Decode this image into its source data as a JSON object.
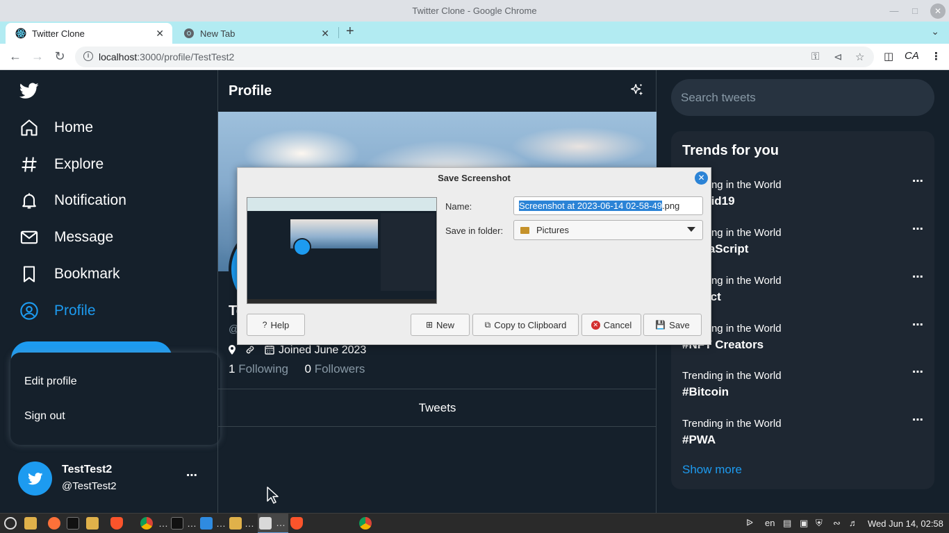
{
  "window": {
    "title": "Twitter Clone - Google Chrome"
  },
  "tabs": [
    {
      "label": "Twitter Clone"
    },
    {
      "label": "New Tab"
    }
  ],
  "address": {
    "host": "localhost",
    "path": ":3000/profile/TestTest2"
  },
  "nav": {
    "items": [
      "Home",
      "Explore",
      "Notification",
      "Message",
      "Bookmark",
      "Profile"
    ]
  },
  "menu": {
    "edit_profile": "Edit profile",
    "sign_out": "Sign out"
  },
  "account": {
    "name": "TestTest2",
    "handle": "@TestTest2"
  },
  "profile": {
    "header": "Profile",
    "joined": "Joined June 2023",
    "following_count": "1",
    "following_label": "Following",
    "followers_count": "0",
    "followers_label": "Followers",
    "tab": "Tweets"
  },
  "sidebar": {
    "search_placeholder": "Search tweets",
    "trends_title": "Trends for you",
    "trends": [
      {
        "category": "Trending in the World",
        "tag": "#Covid19"
      },
      {
        "category": "Trending in the World",
        "tag": "#JavaScript"
      },
      {
        "category": "Trending in the World",
        "tag": "#React"
      },
      {
        "category": "Trending in the World",
        "tag": "#NFT Creators"
      },
      {
        "category": "Trending in the World",
        "tag": "#Bitcoin"
      },
      {
        "category": "Trending in the World",
        "tag": "#PWA"
      }
    ],
    "show_more": "Show more"
  },
  "dialog": {
    "title": "Save Screenshot",
    "name_label": "Name:",
    "name_selected": "Screenshot at 2023-06-14 02-58-49",
    "name_ext": ".png",
    "folder_label": "Save in folder:",
    "folder_value": "Pictures",
    "buttons": {
      "help": "Help",
      "new": "New",
      "copy": "Copy to Clipboard",
      "cancel": "Cancel",
      "save": "Save"
    }
  },
  "taskbar": {
    "lang": "en",
    "clock": "Wed Jun 14, 02:58"
  },
  "colors": {
    "accent": "#1d9bf0",
    "background": "#15202b",
    "card": "#1e2732",
    "tabstrip": "#b2ebf2"
  }
}
